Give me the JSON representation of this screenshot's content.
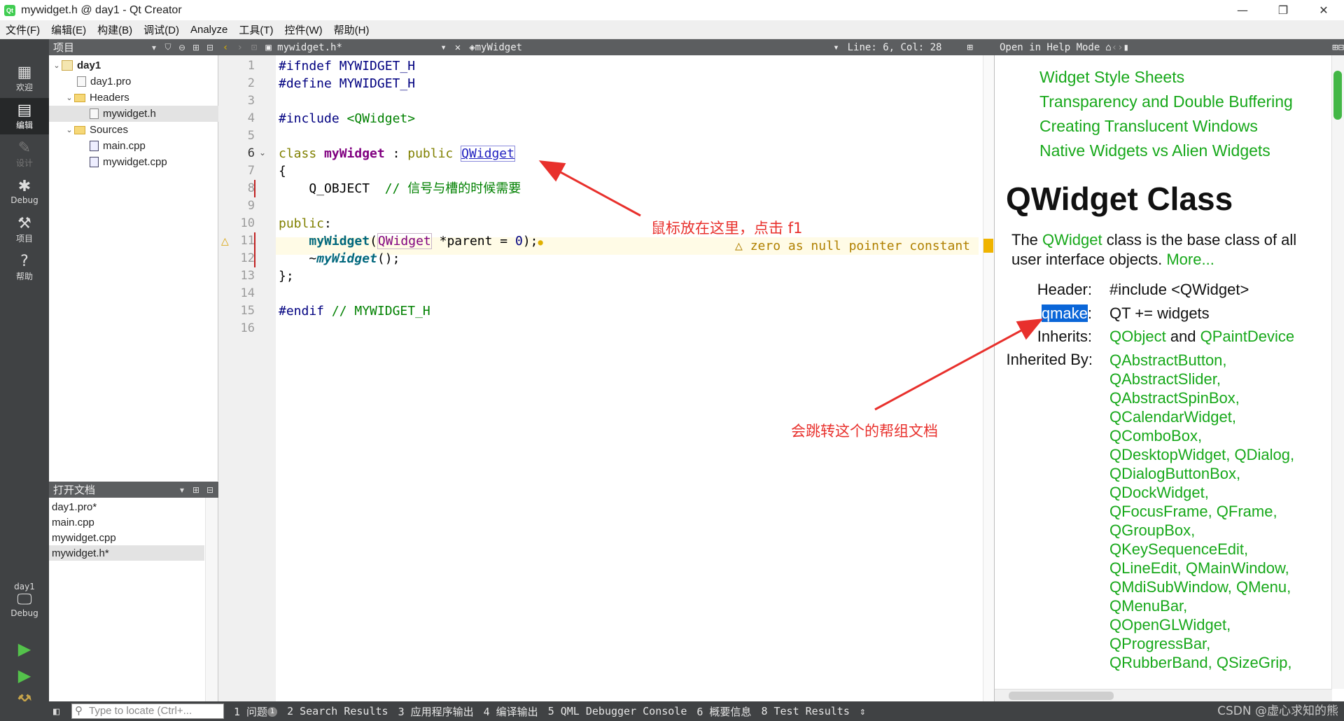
{
  "window": {
    "title": "mywidget.h @ day1 - Qt Creator",
    "app_icon_text": "Qt",
    "minimize": "—",
    "maximize": "❐",
    "close": "✕"
  },
  "menu": [
    "文件(F)",
    "编辑(E)",
    "构建(B)",
    "调试(D)",
    "Analyze",
    "工具(T)",
    "控件(W)",
    "帮助(H)"
  ],
  "modes": [
    {
      "label": "欢迎",
      "icon": "grid-icon"
    },
    {
      "label": "编辑",
      "icon": "edit-icon"
    },
    {
      "label": "设计",
      "icon": "design-icon"
    },
    {
      "label": "Debug",
      "icon": "bug-icon"
    },
    {
      "label": "项目",
      "icon": "wrench-icon"
    },
    {
      "label": "帮助",
      "icon": "help-icon"
    }
  ],
  "kit": {
    "project": "day1",
    "config": "Debug"
  },
  "project_pane": {
    "title": "项目",
    "tree": [
      {
        "label": "day1",
        "level": 0,
        "bold": true,
        "expanded": true
      },
      {
        "label": "day1.pro",
        "level": 1
      },
      {
        "label": "Headers",
        "level": 1,
        "expanded": true
      },
      {
        "label": "mywidget.h",
        "level": 2,
        "selected": true
      },
      {
        "label": "Sources",
        "level": 1,
        "expanded": true
      },
      {
        "label": "main.cpp",
        "level": 2
      },
      {
        "label": "mywidget.cpp",
        "level": 2
      }
    ]
  },
  "open_docs": {
    "title": "打开文档",
    "items": [
      "day1.pro*",
      "main.cpp",
      "mywidget.cpp",
      "mywidget.h*"
    ],
    "selected": 3
  },
  "editor_toolbar": {
    "file": "mywidget.h*",
    "symbol": "myWidget",
    "position": "Line: 6, Col: 28"
  },
  "help_toolbar": {
    "mode": "Open in Help Mode"
  },
  "editor": {
    "line_numbers": [
      "1",
      "2",
      "3",
      "4",
      "5",
      "6",
      "7",
      "8",
      "9",
      "10",
      "11",
      "12",
      "13",
      "14",
      "15",
      "16"
    ],
    "warning": "zero as null pointer constant"
  },
  "annotations": {
    "a1": "鼠标放在这里，点击 f1",
    "a2": "会跳转这个的帮组文档"
  },
  "help": {
    "toc": [
      "Widget Style Sheets",
      "Transparency and Double Buffering",
      "Creating Translucent Windows",
      "Native Widgets vs Alien Widgets"
    ],
    "heading": "QWidget Class",
    "intro_pre": "The ",
    "intro_link": "QWidget",
    "intro_post": " class is the base class of all user interface objects. ",
    "more": "More...",
    "header_key": "Header:",
    "header_val": "#include <QWidget>",
    "qmake_key": "qmake",
    "qmake_colon": ":",
    "qmake_val": "QT += widgets",
    "inherits_key": "Inherits:",
    "inherits_a": "QObject",
    "inherits_and": " and ",
    "inherits_b": "QPaintDevice",
    "inherited_key": "Inherited By:",
    "inherited_by": [
      "QAbstractButton,",
      "QAbstractSlider,",
      "QAbstractSpinBox,",
      "QCalendarWidget,",
      "QComboBox,",
      "QDesktopWidget, QDialog,",
      "QDialogButtonBox,",
      "QDockWidget,",
      "QFocusFrame, QFrame,",
      "QGroupBox,",
      "QKeySequenceEdit,",
      "QLineEdit, QMainWindow,",
      "QMdiSubWindow, QMenu,",
      "QMenuBar,",
      "QOpenGLWidget,",
      "QProgressBar,",
      "QRubberBand, QSizeGrip,"
    ]
  },
  "status": {
    "locate_placeholder": "Type to locate (Ctrl+...",
    "panes": [
      "1 问题",
      "2 Search Results",
      "3 应用程序输出",
      "4 编译输出",
      "5 QML Debugger Console",
      "6 概要信息",
      "8 Test Results"
    ],
    "issues_badge": "1",
    "watermark": "CSDN @虚心求知的熊"
  },
  "colors": {
    "accent_green": "#17a81a",
    "annotation_red": "#e8302c",
    "selection_blue": "#0a66d8"
  }
}
